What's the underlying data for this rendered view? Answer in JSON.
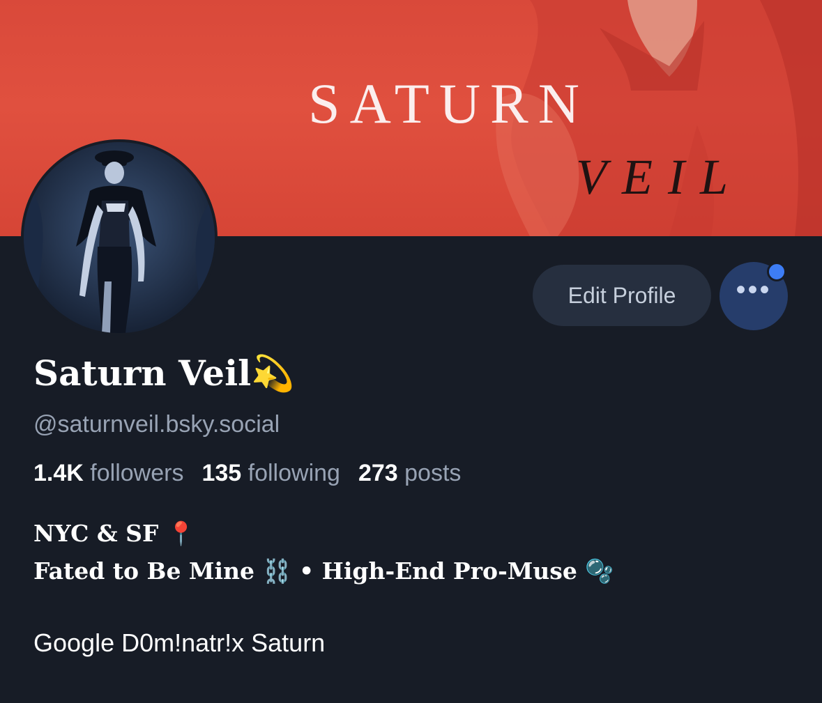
{
  "banner": {
    "title": "SATURN",
    "subtitle": "VEIL"
  },
  "profile": {
    "display_name": "Saturn Veil",
    "name_emoji": "💫",
    "handle": "@saturnveil.bsky.social",
    "stats": [
      {
        "value": "1.4K",
        "label": "followers"
      },
      {
        "value": "135",
        "label": "following"
      },
      {
        "value": "273",
        "label": "posts"
      }
    ],
    "bio": {
      "line1_text": "NYC & SF",
      "line1_emoji": "📍",
      "line2_part1": "Fated to Be Mine",
      "line2_emoji1": "⛓️",
      "line2_sep": "•",
      "line2_part2": "High-End Pro-Muse",
      "line2_emoji2": "🫧",
      "line3": "Google D0m!natr!x Saturn"
    }
  },
  "actions": {
    "edit_profile_label": "Edit Profile",
    "more_label": "•••"
  },
  "icons": {
    "more": "more-options-icon",
    "notification": "notification-dot-icon"
  },
  "colors": {
    "background": "#171c26",
    "banner": "#dd4c3c",
    "edit_button": "#262f3f",
    "more_button": "#263d6b",
    "notification_dot": "#3d7df5",
    "muted_text": "#98a3b4"
  }
}
